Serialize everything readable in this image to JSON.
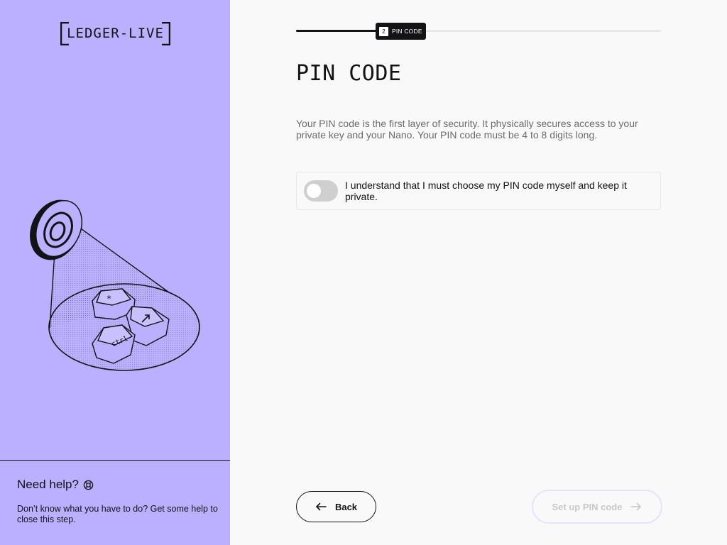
{
  "sidebar": {
    "logo_text": "LEDGER-LIVE",
    "help": {
      "title": "Need help?",
      "icon": "lifebuoy-icon",
      "text": "Don’t know what you have to do? Get some help to close this step."
    }
  },
  "stepper": {
    "step_number": "2",
    "step_label": "PIN CODE",
    "progress": 0.23
  },
  "main": {
    "title": "PIN CODE",
    "description": "Your PIN code is the first layer of security. It physically secures access to your private key and your Nano. Your PIN code must be 4 to 8 digits long.",
    "acknowledgement": {
      "label": "I understand that I must choose my PIN code myself and keep it private.",
      "checked": false
    }
  },
  "footer": {
    "back_label": "Back",
    "next_label": "Set up PIN code",
    "next_enabled": false
  },
  "colors": {
    "sidebar_bg": "#bbb0ff",
    "page_bg": "#f9f9f9",
    "text_dark": "#131214",
    "text_muted": "#6b6b6b"
  }
}
